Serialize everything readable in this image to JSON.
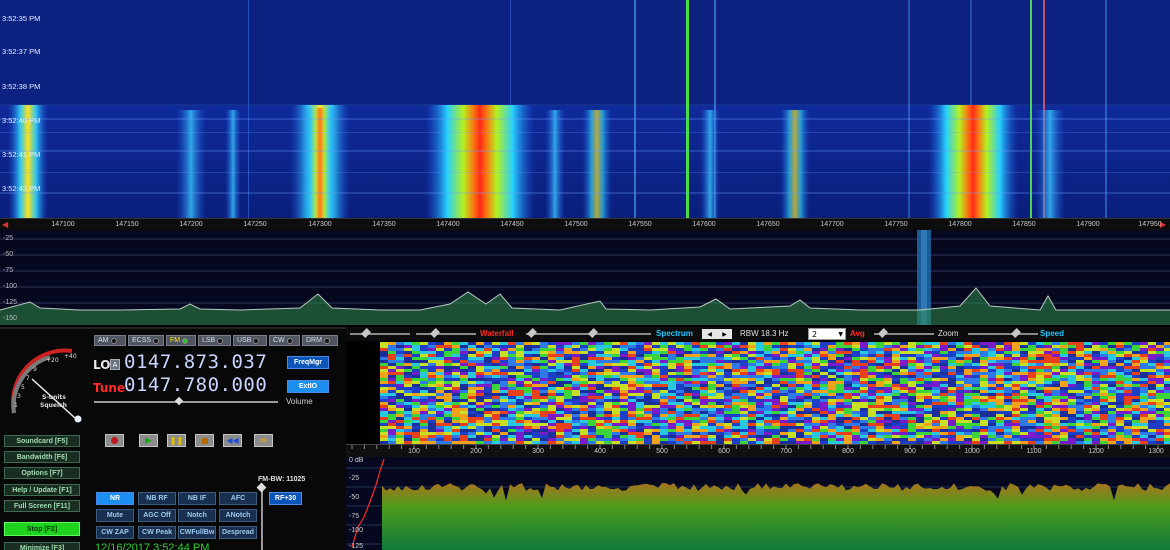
{
  "top_waterfall": {
    "timestamps": [
      "3:52:35 PM",
      "3:52:37 PM",
      "3:52:38 PM",
      "3:52:40 PM",
      "3:52:41 PM",
      "3:52:43 PM"
    ]
  },
  "frequency_axis": {
    "labels": [
      "147100",
      "147150",
      "147200",
      "147250",
      "147300",
      "147350",
      "147400",
      "147450",
      "147500",
      "147550",
      "147600",
      "147650",
      "147700",
      "147750",
      "147800",
      "147850",
      "147900",
      "147950"
    ]
  },
  "spectrum": {
    "db_labels": [
      "-25",
      "-50",
      "-75",
      "-100",
      "-125",
      "-150"
    ]
  },
  "smeter": {
    "labels": [
      "+40",
      "+20",
      "9",
      "7",
      "5",
      "3",
      "1"
    ],
    "caption_top": "S-units",
    "caption_bottom": "Squelch"
  },
  "modes": [
    {
      "label": "AM",
      "active": false
    },
    {
      "label": "ECSS",
      "active": false
    },
    {
      "label": "FM",
      "active": true
    },
    {
      "label": "LSB",
      "active": false
    },
    {
      "label": "USB",
      "active": false
    },
    {
      "label": "CW",
      "active": false
    },
    {
      "label": "DRM",
      "active": false
    }
  ],
  "lo": {
    "label": "LO",
    "lock_icon_text": "A",
    "value": "0147.873.037"
  },
  "tune": {
    "label": "Tune",
    "value": "0147.780.000"
  },
  "buttons": {
    "freqmgr": "FreqMgr",
    "extio": "ExtIO",
    "volume": "Volume",
    "soundcard": "Soundcard  [F5]",
    "bandwidth": "Bandwidth  [F6]",
    "options": "Options   [F7]",
    "help": "Help / Update  [F1]",
    "fullscreen": "Full Screen  [F11]",
    "stop": "Stop       [F2]",
    "minimize": "Minimize  [F3]"
  },
  "fm_bw": "FM-BW: 11025",
  "rf_button": "RF+30",
  "dsp_buttons": {
    "nr": "NR",
    "nb_rf": "NB RF",
    "nb_if": "NB IF",
    "afc": "AFC",
    "mute": "Mute",
    "agc_off": "AGC Off",
    "notch": "Notch",
    "anotch": "ANotch",
    "cw_zap": "CW ZAP",
    "cw_peak": "CW Peak",
    "cw_fullbw": "CWFullBw",
    "despread": "Despread"
  },
  "datetime": "12/16/2017 3:52:44 PM",
  "toolbar": {
    "waterfall": "Waterfall",
    "spectrum": "Spectrum",
    "rbw": "RBW 18.3 Hz",
    "avg_value": "2",
    "avg": "Avg",
    "zoom": "Zoom",
    "speed": "Speed"
  },
  "audio_axis": {
    "labels": [
      "100",
      "200",
      "300",
      "400",
      "500",
      "600",
      "700",
      "800",
      "900",
      "1000",
      "1100",
      "1200",
      "1300"
    ]
  },
  "audio_spectrum": {
    "db_labels": [
      "0 dB",
      "-25",
      "-50",
      "-75",
      "-100",
      "-125"
    ]
  },
  "colors": {
    "waterfall_bg": "#0c2180",
    "accent_cyan": "#1fc8ff",
    "waterfall_red": "#ff2a2a",
    "active_green": "#1ed21e"
  }
}
